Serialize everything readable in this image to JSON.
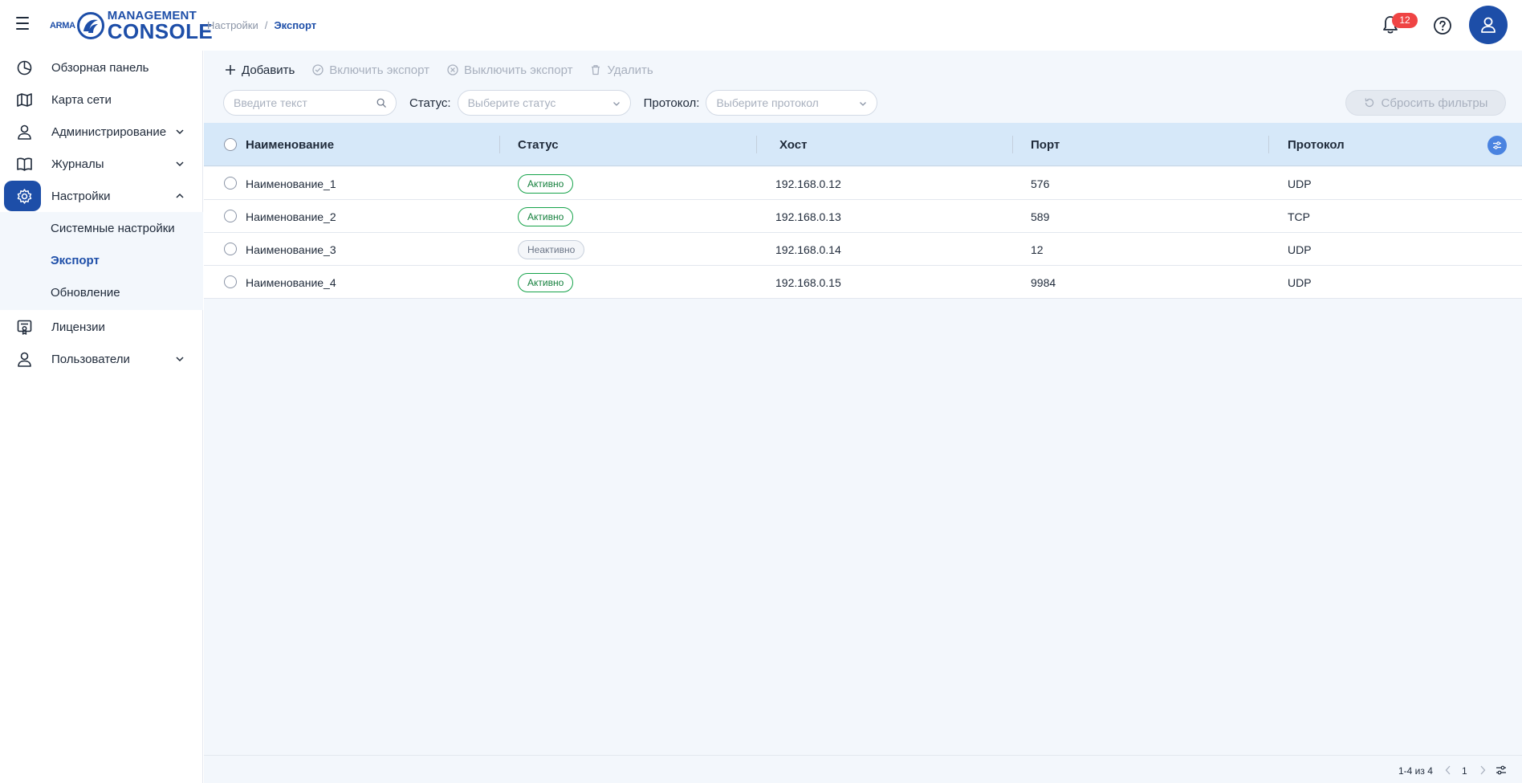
{
  "header": {
    "logo": {
      "brand": "ARMA",
      "line1": "MANAGEMENT",
      "line2": "CONSOLE"
    },
    "breadcrumb": {
      "parent": "Настройки",
      "separator": "/",
      "current": "Экспорт"
    },
    "notifications_count": "12",
    "icons": [
      "menu-icon",
      "bell-icon",
      "help-icon",
      "user-icon"
    ]
  },
  "sidebar": {
    "items": [
      {
        "label": "Обзорная панель",
        "icon": "dashboard-icon"
      },
      {
        "label": "Карта сети",
        "icon": "map-icon"
      },
      {
        "label": "Администрирование",
        "icon": "user-icon"
      },
      {
        "label": "Журналы",
        "icon": "book-icon"
      },
      {
        "label": "Настройки",
        "icon": "gear-icon"
      },
      {
        "label": "Лицензии",
        "icon": "license-icon"
      },
      {
        "label": "Пользователи",
        "icon": "user-icon"
      }
    ],
    "submenu": [
      {
        "label": "Системные настройки"
      },
      {
        "label": "Экспорт"
      },
      {
        "label": "Обновление"
      }
    ]
  },
  "toolbar": {
    "add": "Добавить",
    "enable": "Включить экспорт",
    "disable": "Выключить экспорт",
    "delete": "Удалить"
  },
  "filters": {
    "search_placeholder": "Введите текст",
    "status_label": "Статус",
    "status_placeholder": "Выберите статус",
    "protocol_label": "Протокол",
    "protocol_placeholder": "Выберите протокол",
    "reset": "Сбросить фильтры"
  },
  "table": {
    "columns": [
      "Наименование",
      "Статус",
      "Хост",
      "Порт",
      "Протокол"
    ],
    "rows": [
      {
        "name": "Наименование_1",
        "status": "Активно",
        "host": "192.168.0.12",
        "port": "576",
        "protocol": "UDP"
      },
      {
        "name": "Наименование_2",
        "status": "Активно",
        "host": "192.168.0.13",
        "port": "589",
        "protocol": "TCP"
      },
      {
        "name": "Наименование_3",
        "status": "Неактивно",
        "host": "192.168.0.14",
        "port": "12",
        "protocol": "UDP"
      },
      {
        "name": "Наименование_4",
        "status": "Активно",
        "host": "192.168.0.15",
        "port": "9984",
        "protocol": "UDP"
      }
    ]
  },
  "pagination": {
    "range": "1-4 из 4",
    "page": "1"
  },
  "colors": {
    "primary": "#1d4ea8",
    "active_status": "#16a34a",
    "badge": "#ef4444",
    "header_bg": "#d6e8f9",
    "content_bg": "#f3f7fc"
  }
}
